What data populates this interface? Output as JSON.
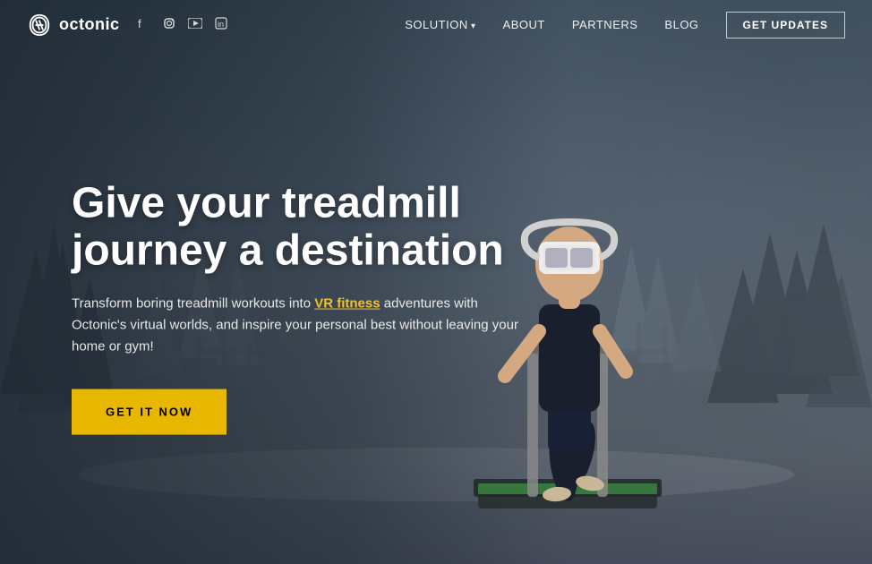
{
  "brand": {
    "name": "octonic",
    "logo_alt": "Octonic logo"
  },
  "social": {
    "facebook": "f",
    "instagram": "in",
    "youtube": "▶",
    "linkedin": "in"
  },
  "nav": {
    "solution_label": "SOLUTION",
    "about_label": "ABOUT",
    "partners_label": "PARTNERS",
    "blog_label": "BLOG",
    "cta_label": "GET UPDATES"
  },
  "hero": {
    "title": "Give your treadmill journey a destination",
    "subtitle_start": "Transform boring treadmill workouts into ",
    "subtitle_highlight": "VR fitness",
    "subtitle_end": " adventures with Octonic's virtual worlds, and inspire your personal best without leaving your home or gym!",
    "cta_button": "GET IT NOW"
  },
  "colors": {
    "cta_bg": "#e8b800",
    "highlight": "#f0c030"
  }
}
